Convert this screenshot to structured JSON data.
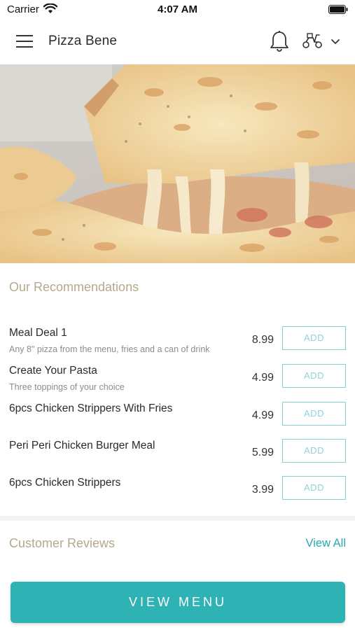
{
  "status_bar": {
    "carrier": "Carrier",
    "time": "4:07 AM"
  },
  "header": {
    "title": "Pizza Bene",
    "menu_icon": "hamburger-menu-icon",
    "notification_icon": "bell-icon",
    "delivery_icon": "scooter-icon",
    "dropdown_icon": "chevron-down-icon"
  },
  "hero": {
    "image": "cheese-pizza-slice-photo"
  },
  "recommendations": {
    "title": "Our Recommendations",
    "items": [
      {
        "name": "Meal Deal 1",
        "description": "Any 8\" pizza from the menu, fries and a can of drink",
        "price": "8.99",
        "button": "ADD"
      },
      {
        "name": "Create Your Pasta",
        "description": "Three toppings of your choice",
        "price": "4.99",
        "button": "ADD"
      },
      {
        "name": "6pcs Chicken Strippers With Fries",
        "description": "",
        "price": "4.99",
        "button": "ADD"
      },
      {
        "name": "Peri Peri Chicken Burger Meal",
        "description": "",
        "price": "5.99",
        "button": "ADD"
      },
      {
        "name": "6pcs Chicken Strippers",
        "description": "",
        "price": "3.99",
        "button": "ADD"
      }
    ]
  },
  "reviews": {
    "title": "Customer Reviews",
    "view_all": "View All"
  },
  "footer": {
    "view_menu": "VIEW MENU"
  },
  "colors": {
    "accent": "#2fb2b3",
    "section_title": "#b6a88a",
    "add_button_border": "#7fd0cf"
  }
}
